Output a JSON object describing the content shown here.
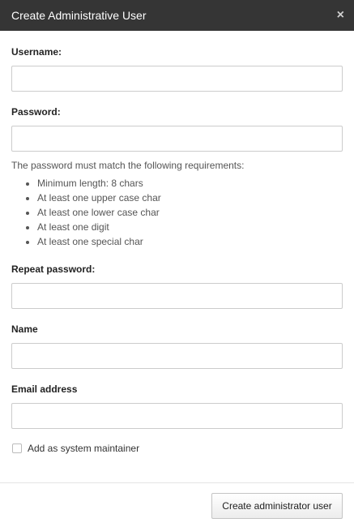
{
  "dialog": {
    "title": "Create Administrative User",
    "close_label": "×"
  },
  "form": {
    "username_label": "Username:",
    "password_label": "Password:",
    "password_hint": "The password must match the following requirements:",
    "requirements": [
      "Minimum length: 8 chars",
      "At least one upper case char",
      "At least one lower case char",
      "At least one digit",
      "At least one special char"
    ],
    "repeat_password_label": "Repeat password:",
    "name_label": "Name",
    "email_label": "Email address",
    "maintainer_checkbox_label": "Add as system maintainer",
    "maintainer_checked": false
  },
  "footer": {
    "submit_label": "Create administrator user"
  }
}
